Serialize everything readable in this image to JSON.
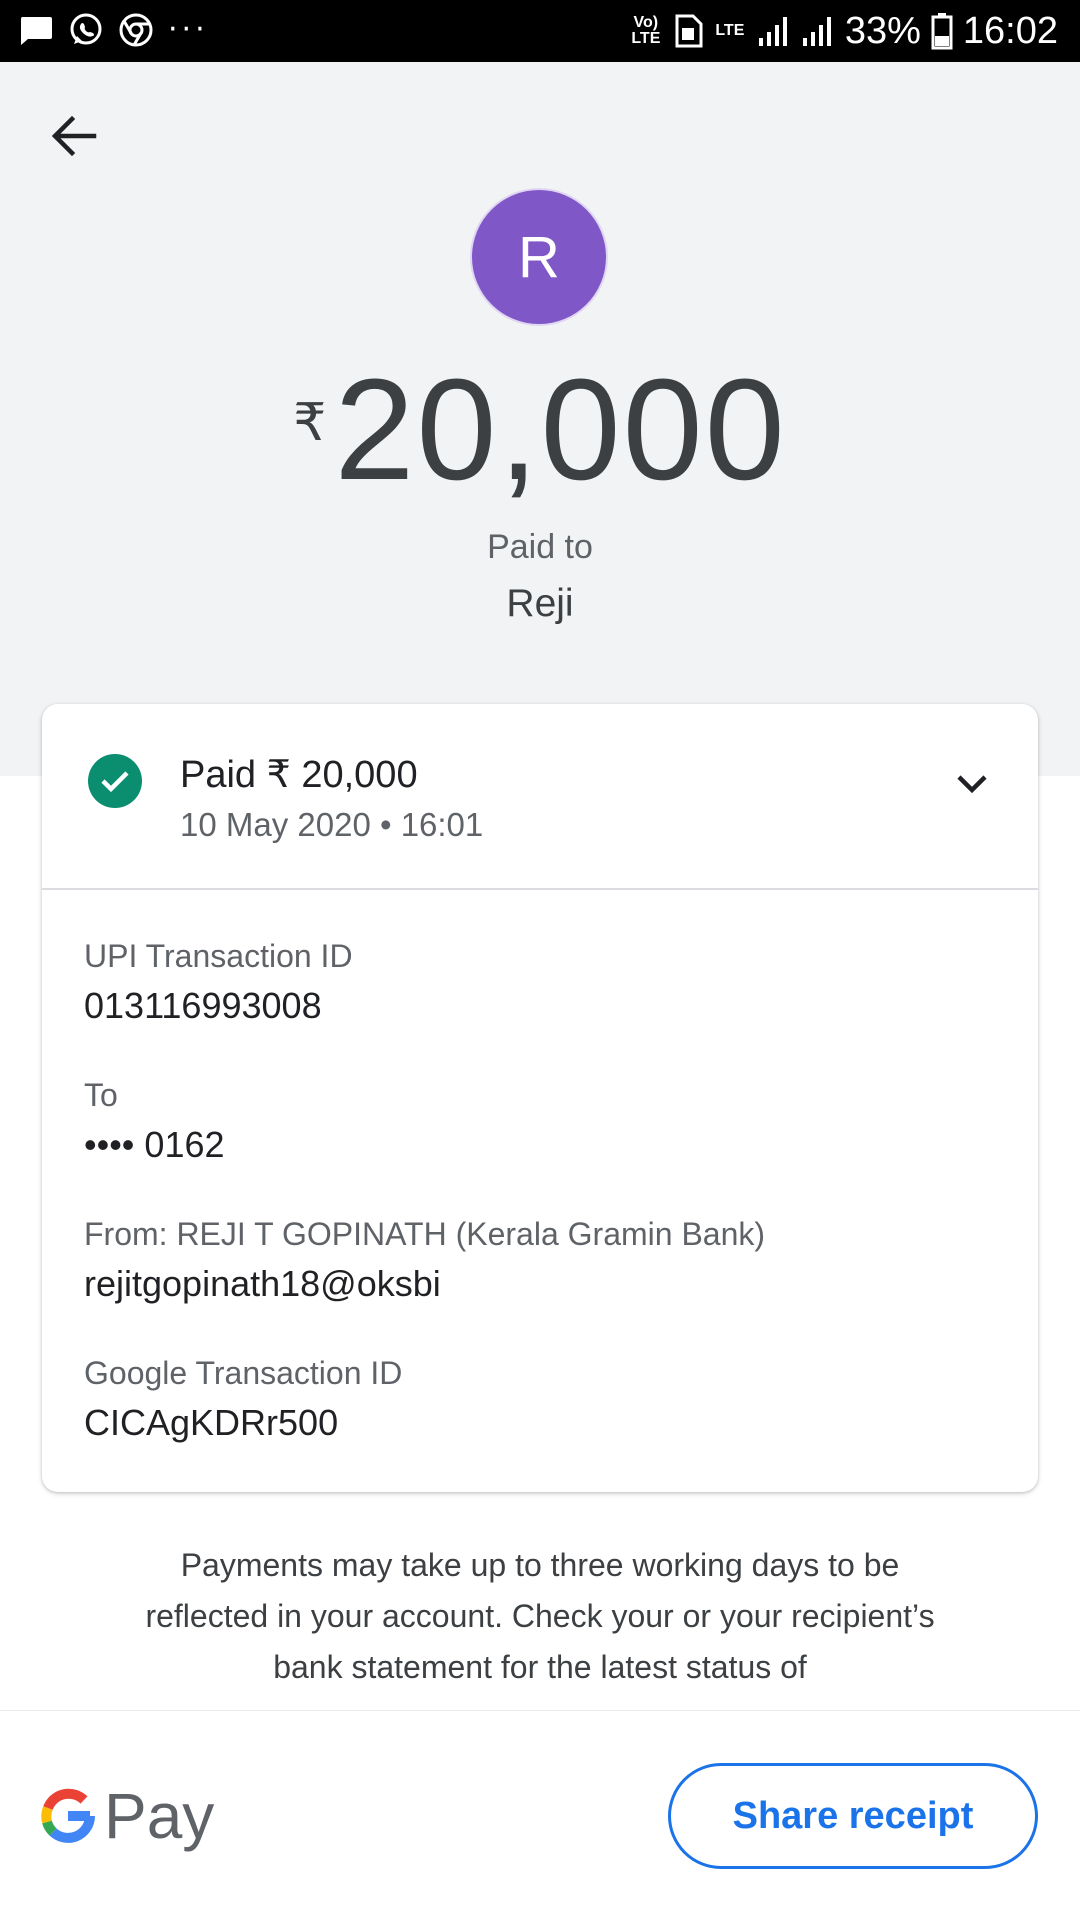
{
  "status_bar": {
    "volte": "Vo) LTE",
    "lte": "LTE",
    "battery": "33%",
    "time": "16:02",
    "dots": "···"
  },
  "header": {
    "avatar_initial": "R",
    "avatar_color": "#8057c7",
    "currency_symbol": "₹",
    "amount": "20,000",
    "paid_to_label": "Paid to",
    "payee_name": "Reji"
  },
  "card": {
    "status_title": "Paid ₹ 20,000",
    "status_date": "10 May 2020 • 16:01",
    "status_color": "#0b8e6f",
    "details": [
      {
        "label": "UPI Transaction ID",
        "value": "013116993008"
      },
      {
        "label": "To",
        "value": "•••• 0162"
      },
      {
        "label": "From: REJI T GOPINATH (Kerala Gramin Bank)",
        "value": "rejitgopinath18@oksbi"
      },
      {
        "label": "Google Transaction ID",
        "value": "CICAgKDRr500"
      }
    ]
  },
  "notice": "Payments may take up to three working days to be reflected in your account. Check your or your recipient’s bank statement for the latest status of",
  "bottom": {
    "brand": "Pay",
    "share_label": "Share receipt",
    "accent": "#1a73e8"
  }
}
